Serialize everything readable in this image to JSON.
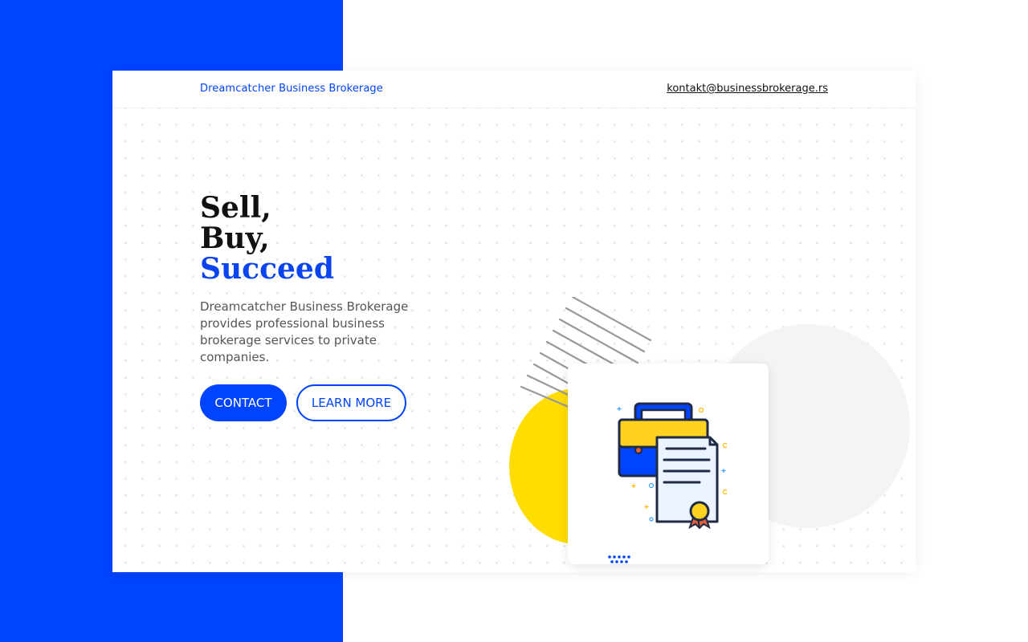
{
  "header": {
    "brand": "Dreamcatcher Business Brokerage",
    "email": "kontakt@businessbrokerage.rs"
  },
  "hero": {
    "headline": [
      "Sell,",
      "Buy,",
      "Succeed"
    ],
    "description": "Dreamcatcher Business Brokerage provides professional business brokerage services to private companies.",
    "buttons": {
      "contact": "CONTACT",
      "learn_more": "LEARN MORE"
    }
  },
  "illustration": {
    "icon": "briefcase-certificate-icon",
    "colors": {
      "brand_blue": "#0044ff",
      "accent_yellow": "#ffdd00",
      "circle_grey": "#f4f4f4",
      "stripe_grey": "#999999"
    }
  }
}
